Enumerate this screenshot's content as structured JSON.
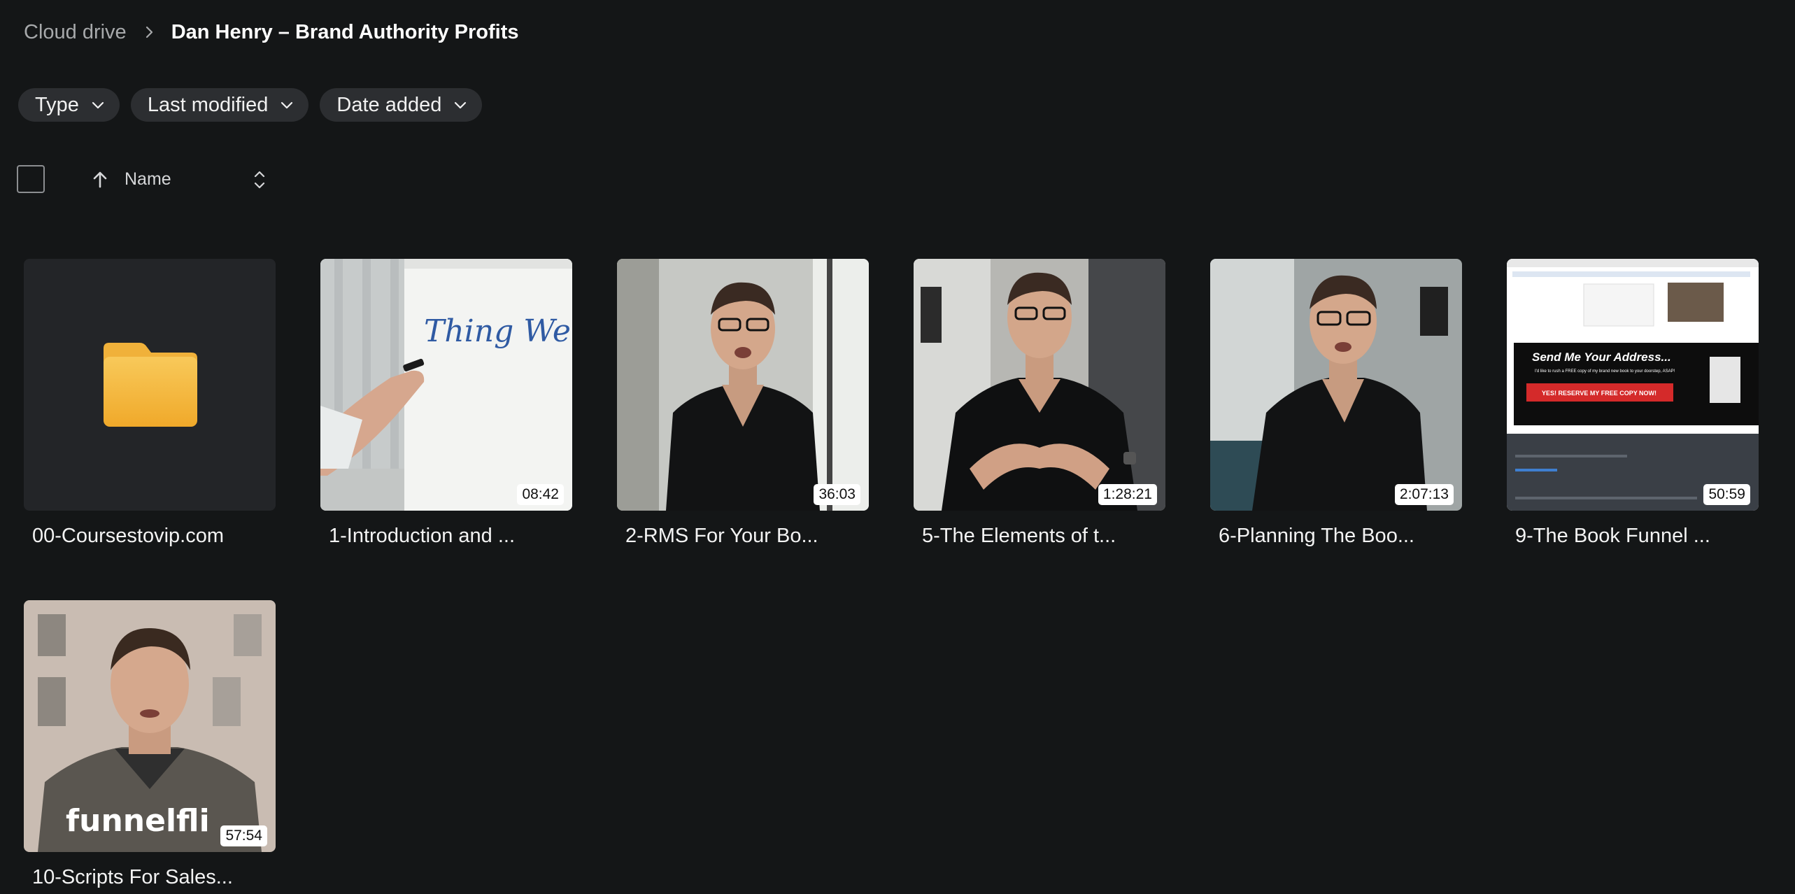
{
  "breadcrumb": {
    "root": "Cloud drive",
    "current": "Dan Henry – Brand Authority Profits"
  },
  "filters": [
    {
      "label": "Type"
    },
    {
      "label": "Last modified"
    },
    {
      "label": "Date added"
    }
  ],
  "list_header": {
    "name_label": "Name"
  },
  "items": [
    {
      "name": "00-Coursestovip.com",
      "kind": "folder",
      "duration": ""
    },
    {
      "name": "1-Introduction and ...",
      "kind": "video",
      "duration": "08:42"
    },
    {
      "name": "2-RMS For Your Bo...",
      "kind": "video",
      "duration": "36:03"
    },
    {
      "name": "5-The Elements of t...",
      "kind": "video",
      "duration": "1:28:21"
    },
    {
      "name": "6-Planning The Boo...",
      "kind": "video",
      "duration": "2:07:13"
    },
    {
      "name": "9-The Book Funnel ...",
      "kind": "video",
      "duration": "50:59"
    },
    {
      "name": "10-Scripts For Sales...",
      "kind": "video",
      "duration": "57:54"
    }
  ],
  "thumbnail_text": {
    "whiteboard_writing": "Thing We Are Tryi",
    "funnel_headline": "Send Me Your Address...",
    "funnel_subtext": "I'd like to rush a FREE copy of my brand new book to your doorstep, ASAP!",
    "funnel_button": "YES! RESERVE MY FREE COPY NOW!",
    "shirt_text": "funnelfli"
  },
  "colors": {
    "background": "#141617",
    "chip": "#2c2e31",
    "folder": "#f5b942",
    "badge_bg": "#ffffff"
  }
}
